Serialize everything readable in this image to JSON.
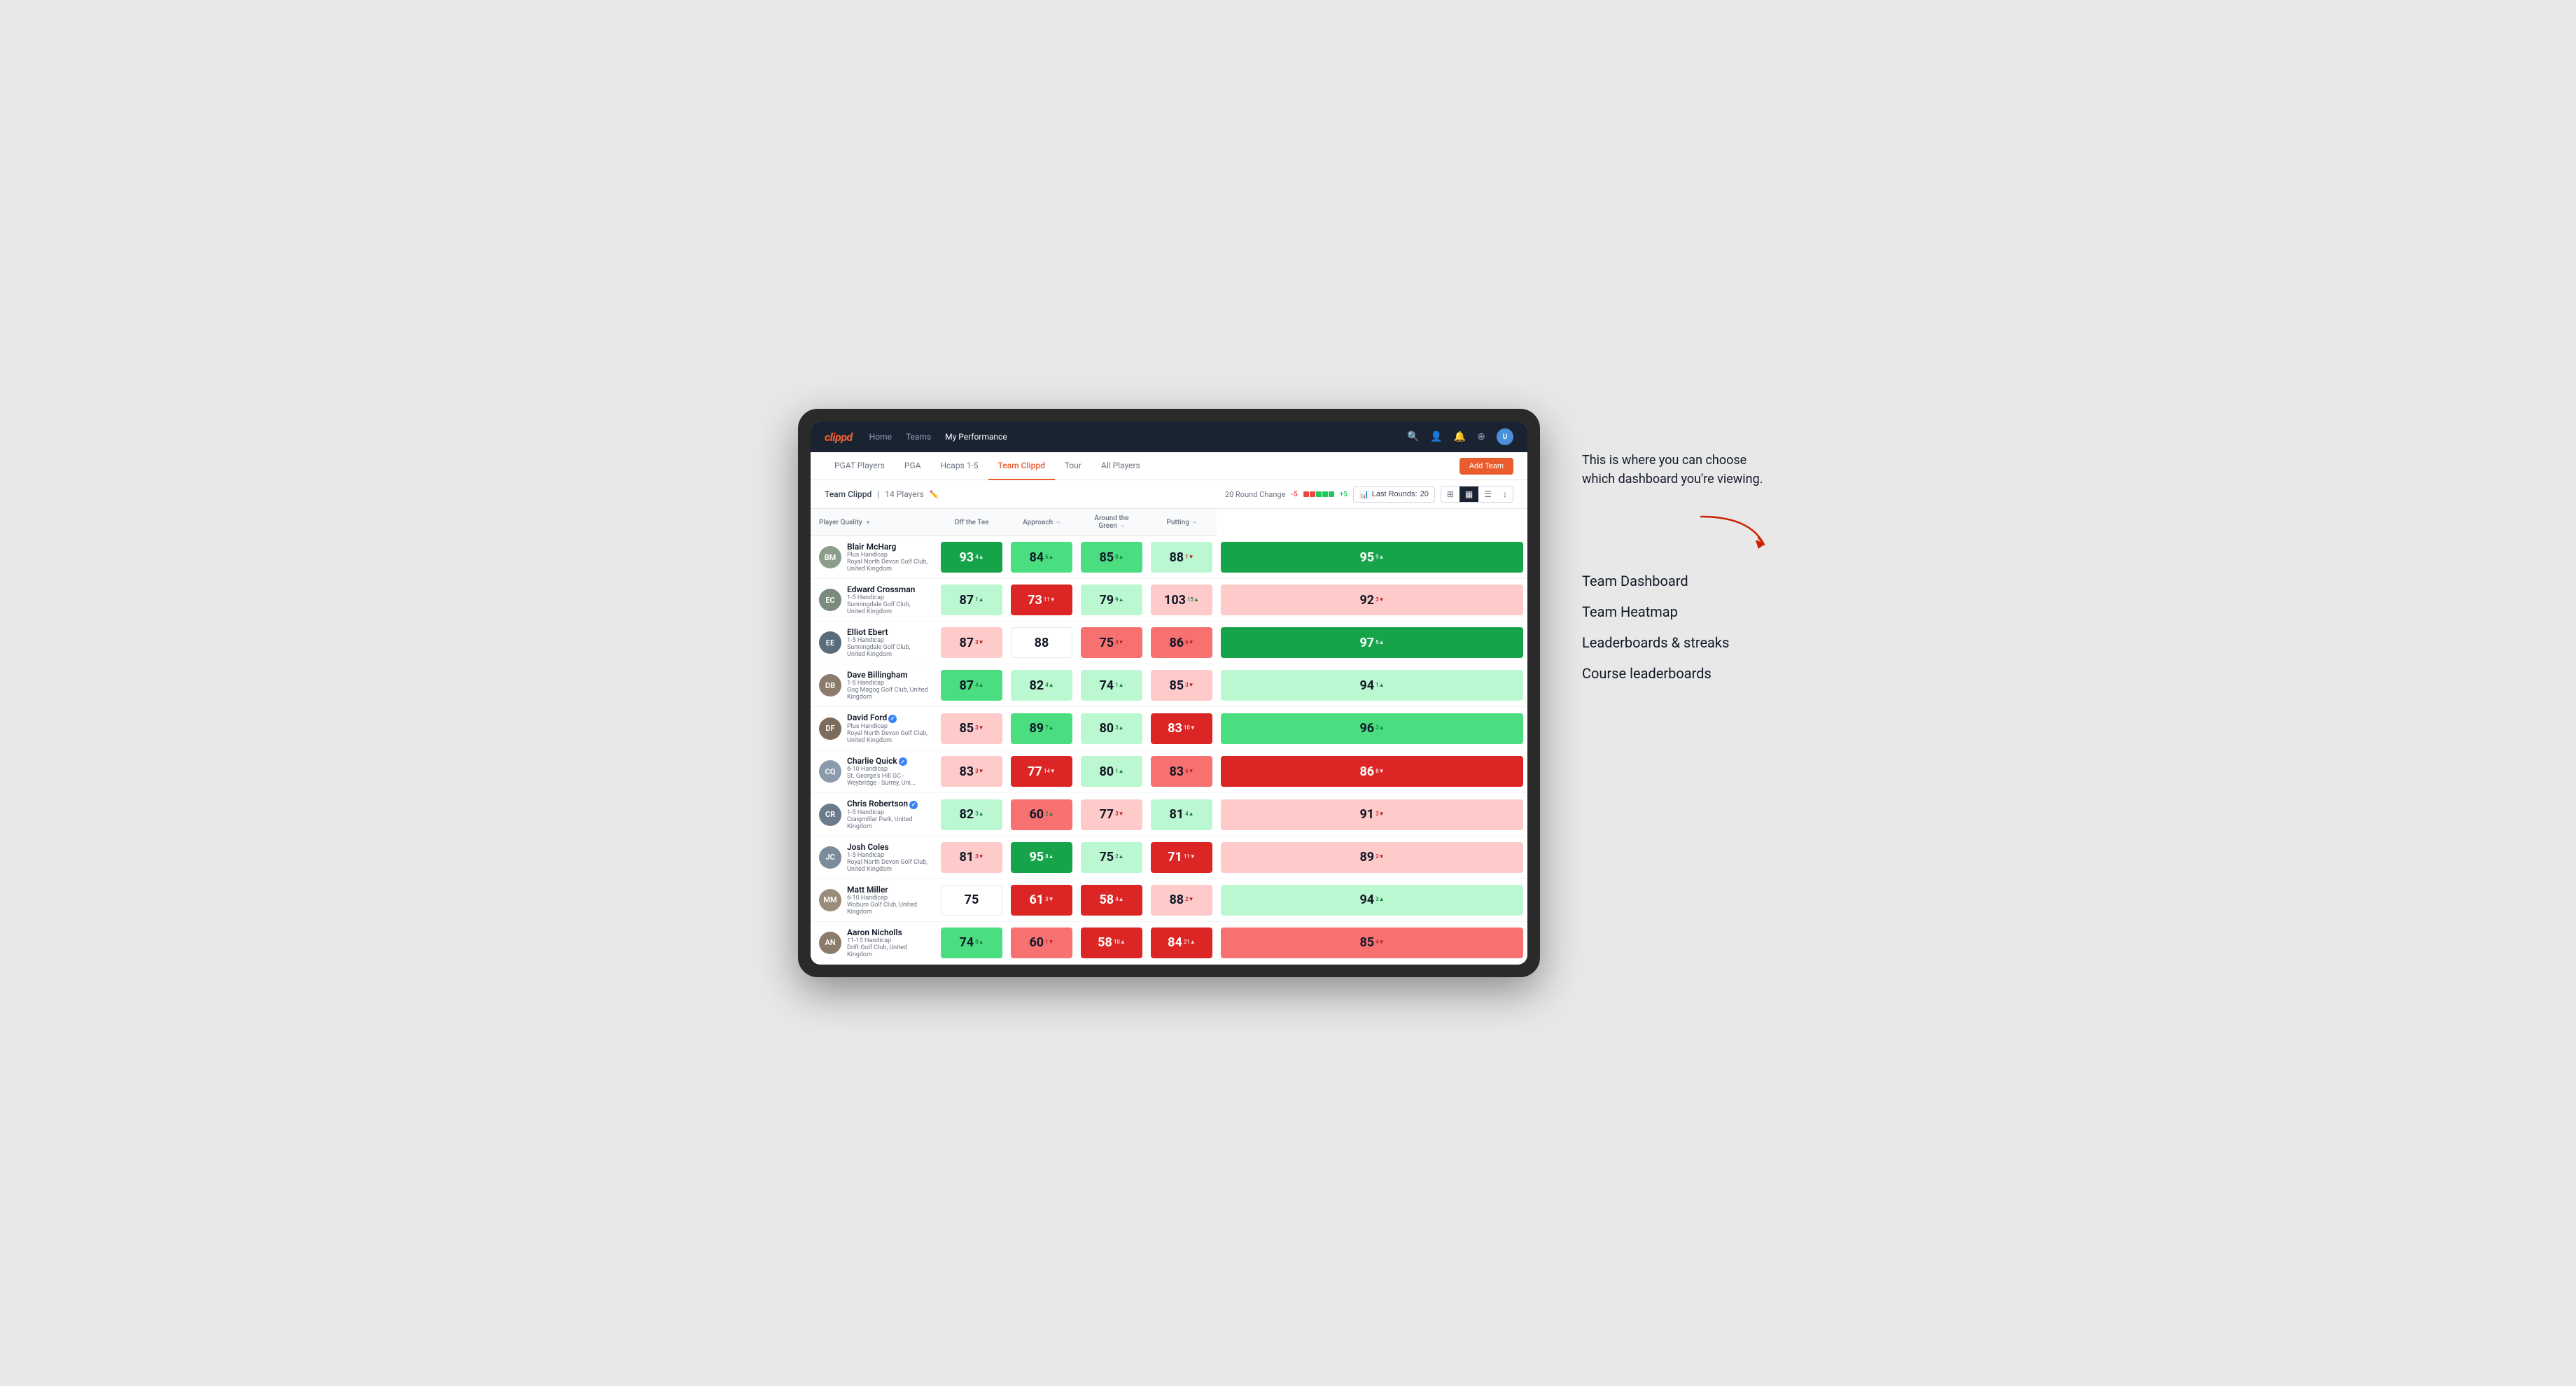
{
  "logo": "clippd",
  "topNav": {
    "links": [
      "Home",
      "Teams",
      "My Performance"
    ],
    "activeLink": "My Performance"
  },
  "subNav": {
    "links": [
      "PGAT Players",
      "PGA",
      "Hcaps 1-5",
      "Team Clippd",
      "Tour",
      "All Players"
    ],
    "activeLink": "Team Clippd",
    "addTeamButton": "Add Team"
  },
  "teamBar": {
    "teamName": "Team Clippd",
    "playerCount": "14 Players",
    "roundChangeLabel": "20 Round Change",
    "changeNeg": "-5",
    "changePos": "+5",
    "lastRoundsLabel": "Last Rounds:",
    "lastRoundsValue": "20"
  },
  "tableHeaders": {
    "playerQuality": "Player Quality",
    "offTheTee": "Off the Tee",
    "approach": "Approach",
    "aroundTheGreen": "Around the Green",
    "putting": "Putting"
  },
  "players": [
    {
      "name": "Blair McHarg",
      "handicap": "Plus Handicap",
      "club": "Royal North Devon Golf Club, United Kingdom",
      "initials": "BM",
      "avatarColor": "#8B9E8B",
      "metrics": {
        "playerQuality": {
          "value": "93",
          "change": "4",
          "dir": "up",
          "bg": "bg-green-strong"
        },
        "offTheTee": {
          "value": "84",
          "change": "6",
          "dir": "up",
          "bg": "bg-green-medium"
        },
        "approach": {
          "value": "85",
          "change": "8",
          "dir": "up",
          "bg": "bg-green-medium"
        },
        "aroundTheGreen": {
          "value": "88",
          "change": "1",
          "dir": "down",
          "bg": "bg-green-light"
        },
        "putting": {
          "value": "95",
          "change": "9",
          "dir": "up",
          "bg": "bg-green-strong"
        }
      }
    },
    {
      "name": "Edward Crossman",
      "handicap": "1-5 Handicap",
      "club": "Sunningdale Golf Club, United Kingdom",
      "initials": "EC",
      "avatarColor": "#7B8B7B",
      "metrics": {
        "playerQuality": {
          "value": "87",
          "change": "1",
          "dir": "up",
          "bg": "bg-green-light"
        },
        "offTheTee": {
          "value": "73",
          "change": "11",
          "dir": "down",
          "bg": "bg-red-strong"
        },
        "approach": {
          "value": "79",
          "change": "9",
          "dir": "up",
          "bg": "bg-green-light"
        },
        "aroundTheGreen": {
          "value": "103",
          "change": "15",
          "dir": "up",
          "bg": "bg-red-light"
        },
        "putting": {
          "value": "92",
          "change": "3",
          "dir": "down",
          "bg": "bg-red-light"
        }
      }
    },
    {
      "name": "Elliot Ebert",
      "handicap": "1-5 Handicap",
      "club": "Sunningdale Golf Club, United Kingdom",
      "initials": "EE",
      "avatarColor": "#5a6b7a",
      "metrics": {
        "playerQuality": {
          "value": "87",
          "change": "3",
          "dir": "down",
          "bg": "bg-red-light"
        },
        "offTheTee": {
          "value": "88",
          "change": "",
          "dir": "",
          "bg": "bg-white"
        },
        "approach": {
          "value": "75",
          "change": "3",
          "dir": "down",
          "bg": "bg-red-medium"
        },
        "aroundTheGreen": {
          "value": "86",
          "change": "6",
          "dir": "down",
          "bg": "bg-red-medium"
        },
        "putting": {
          "value": "97",
          "change": "5",
          "dir": "up",
          "bg": "bg-green-strong"
        }
      }
    },
    {
      "name": "Dave Billingham",
      "handicap": "1-5 Handicap",
      "club": "Gog Magog Golf Club, United Kingdom",
      "initials": "DB",
      "avatarColor": "#8B7B6B",
      "metrics": {
        "playerQuality": {
          "value": "87",
          "change": "4",
          "dir": "up",
          "bg": "bg-green-medium"
        },
        "offTheTee": {
          "value": "82",
          "change": "4",
          "dir": "up",
          "bg": "bg-green-light"
        },
        "approach": {
          "value": "74",
          "change": "1",
          "dir": "up",
          "bg": "bg-green-light"
        },
        "aroundTheGreen": {
          "value": "85",
          "change": "3",
          "dir": "down",
          "bg": "bg-red-light"
        },
        "putting": {
          "value": "94",
          "change": "1",
          "dir": "up",
          "bg": "bg-green-light"
        }
      }
    },
    {
      "name": "David Ford",
      "handicap": "Plus Handicap",
      "club": "Royal North Devon Golf Club, United Kingdom",
      "initials": "DF",
      "verified": true,
      "avatarColor": "#7B6B5B",
      "metrics": {
        "playerQuality": {
          "value": "85",
          "change": "3",
          "dir": "down",
          "bg": "bg-red-light"
        },
        "offTheTee": {
          "value": "89",
          "change": "7",
          "dir": "up",
          "bg": "bg-green-medium"
        },
        "approach": {
          "value": "80",
          "change": "3",
          "dir": "up",
          "bg": "bg-green-light"
        },
        "aroundTheGreen": {
          "value": "83",
          "change": "10",
          "dir": "down",
          "bg": "bg-red-strong"
        },
        "putting": {
          "value": "96",
          "change": "3",
          "dir": "up",
          "bg": "bg-green-medium"
        }
      }
    },
    {
      "name": "Charlie Quick",
      "handicap": "6-10 Handicap",
      "club": "St. George's Hill GC - Weybridge - Surrey, Uni...",
      "initials": "CQ",
      "verified": true,
      "avatarColor": "#8B9BAB",
      "metrics": {
        "playerQuality": {
          "value": "83",
          "change": "3",
          "dir": "down",
          "bg": "bg-red-light"
        },
        "offTheTee": {
          "value": "77",
          "change": "14",
          "dir": "down",
          "bg": "bg-red-strong"
        },
        "approach": {
          "value": "80",
          "change": "1",
          "dir": "up",
          "bg": "bg-green-light"
        },
        "aroundTheGreen": {
          "value": "83",
          "change": "6",
          "dir": "down",
          "bg": "bg-red-medium"
        },
        "putting": {
          "value": "86",
          "change": "8",
          "dir": "down",
          "bg": "bg-red-strong"
        }
      }
    },
    {
      "name": "Chris Robertson",
      "handicap": "1-5 Handicap",
      "club": "Craigmillar Park, United Kingdom",
      "initials": "CR",
      "verified": true,
      "avatarColor": "#6B7B8B",
      "metrics": {
        "playerQuality": {
          "value": "82",
          "change": "3",
          "dir": "up",
          "bg": "bg-green-light"
        },
        "offTheTee": {
          "value": "60",
          "change": "2",
          "dir": "up",
          "bg": "bg-red-medium"
        },
        "approach": {
          "value": "77",
          "change": "3",
          "dir": "down",
          "bg": "bg-red-light"
        },
        "aroundTheGreen": {
          "value": "81",
          "change": "4",
          "dir": "up",
          "bg": "bg-green-light"
        },
        "putting": {
          "value": "91",
          "change": "3",
          "dir": "down",
          "bg": "bg-red-light"
        }
      }
    },
    {
      "name": "Josh Coles",
      "handicap": "1-5 Handicap",
      "club": "Royal North Devon Golf Club, United Kingdom",
      "initials": "JC",
      "avatarColor": "#7B8B9B",
      "metrics": {
        "playerQuality": {
          "value": "81",
          "change": "3",
          "dir": "down",
          "bg": "bg-red-light"
        },
        "offTheTee": {
          "value": "95",
          "change": "8",
          "dir": "up",
          "bg": "bg-green-strong"
        },
        "approach": {
          "value": "75",
          "change": "2",
          "dir": "up",
          "bg": "bg-green-light"
        },
        "aroundTheGreen": {
          "value": "71",
          "change": "11",
          "dir": "down",
          "bg": "bg-red-strong"
        },
        "putting": {
          "value": "89",
          "change": "2",
          "dir": "down",
          "bg": "bg-red-light"
        }
      }
    },
    {
      "name": "Matt Miller",
      "handicap": "6-10 Handicap",
      "club": "Woburn Golf Club, United Kingdom",
      "initials": "MM",
      "avatarColor": "#9B8B7B",
      "metrics": {
        "playerQuality": {
          "value": "75",
          "change": "",
          "dir": "",
          "bg": "bg-white"
        },
        "offTheTee": {
          "value": "61",
          "change": "3",
          "dir": "down",
          "bg": "bg-red-strong"
        },
        "approach": {
          "value": "58",
          "change": "4",
          "dir": "up",
          "bg": "bg-red-strong"
        },
        "aroundTheGreen": {
          "value": "88",
          "change": "2",
          "dir": "down",
          "bg": "bg-red-light"
        },
        "putting": {
          "value": "94",
          "change": "3",
          "dir": "up",
          "bg": "bg-green-light"
        }
      }
    },
    {
      "name": "Aaron Nicholls",
      "handicap": "11-15 Handicap",
      "club": "Drift Golf Club, United Kingdom",
      "initials": "AN",
      "avatarColor": "#8B7B6B",
      "metrics": {
        "playerQuality": {
          "value": "74",
          "change": "8",
          "dir": "up",
          "bg": "bg-green-medium"
        },
        "offTheTee": {
          "value": "60",
          "change": "1",
          "dir": "down",
          "bg": "bg-red-medium"
        },
        "approach": {
          "value": "58",
          "change": "10",
          "dir": "up",
          "bg": "bg-red-strong"
        },
        "aroundTheGreen": {
          "value": "84",
          "change": "21",
          "dir": "up",
          "bg": "bg-red-strong"
        },
        "putting": {
          "value": "85",
          "change": "4",
          "dir": "down",
          "bg": "bg-red-medium"
        }
      }
    }
  ],
  "annotation": {
    "text": "This is where you can choose which dashboard you're viewing.",
    "menuItems": [
      "Team Dashboard",
      "Team Heatmap",
      "Leaderboards & streaks",
      "Course leaderboards"
    ]
  }
}
